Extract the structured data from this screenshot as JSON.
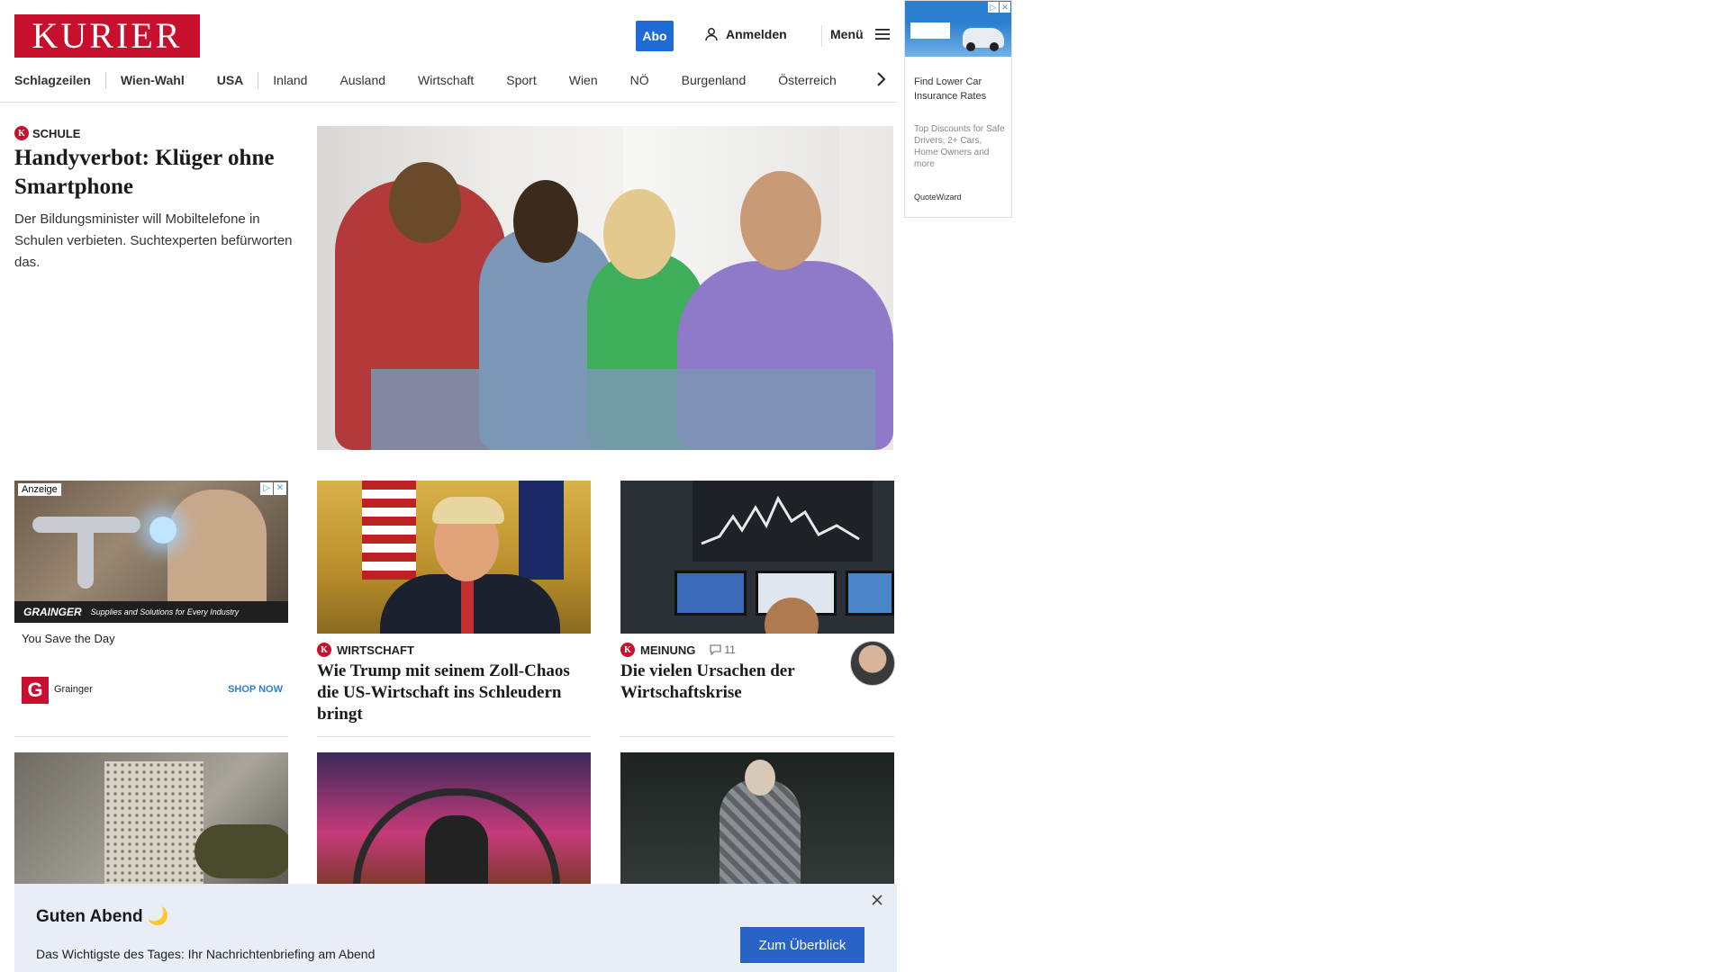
{
  "header": {
    "logo_text": "KURIER",
    "abo_label": "Abo",
    "login_label": "Anmelden",
    "menu_label": "Menü",
    "brand_color": "#c8102e",
    "accent_color": "#1e6bd6"
  },
  "nav": {
    "items": [
      {
        "label": "Schlagzeilen",
        "bold": true
      },
      {
        "label": "Wien-Wahl",
        "bold": true
      },
      {
        "label": "USA",
        "bold": true
      },
      {
        "label": "Inland",
        "bold": false
      },
      {
        "label": "Ausland",
        "bold": false
      },
      {
        "label": "Wirtschaft",
        "bold": false
      },
      {
        "label": "Sport",
        "bold": false
      },
      {
        "label": "Wien",
        "bold": false
      },
      {
        "label": "NÖ",
        "bold": false
      },
      {
        "label": "Burgenland",
        "bold": false
      },
      {
        "label": "Österreich",
        "bold": false
      }
    ],
    "next_icon": "chevron-right-icon"
  },
  "side_ad": {
    "headline": "Find Lower Car Insurance Rates",
    "body": "Top Discounts for Safe Drivers, 2+ Cars, Home Owners and more",
    "advertiser": "QuoteWizard"
  },
  "lead": {
    "kicker": "SCHULE",
    "title": "Handyverbot: Klüger ohne Smartphone",
    "teaser": "Der Bildungsminister will Mobiltelefone in Schulen verbieten. Suchtexperten befürworten das."
  },
  "grid_ad": {
    "badge": "Anzeige",
    "image_tagline_brand": "GRAINGER",
    "image_tagline": "Supplies and Solutions for Every Industry",
    "headline": "You Save the Day",
    "brand": "Grainger",
    "cta": "SHOP NOW"
  },
  "articles": [
    {
      "kicker": "WIRTSCHAFT",
      "title": "Wie Trump mit seinem Zoll-Chaos die US-Wirtschaft ins Schleudern bringt"
    },
    {
      "kicker": "MEINUNG",
      "comments": "11",
      "title": "Die vielen Ursachen der Wirtschaftskrise"
    }
  ],
  "banner": {
    "greeting": "Guten Abend 🌙",
    "text": "Das Wichtigste des Tages: Ihr Nachrichtenbriefing am Abend",
    "cta": "Zum Überblick"
  }
}
